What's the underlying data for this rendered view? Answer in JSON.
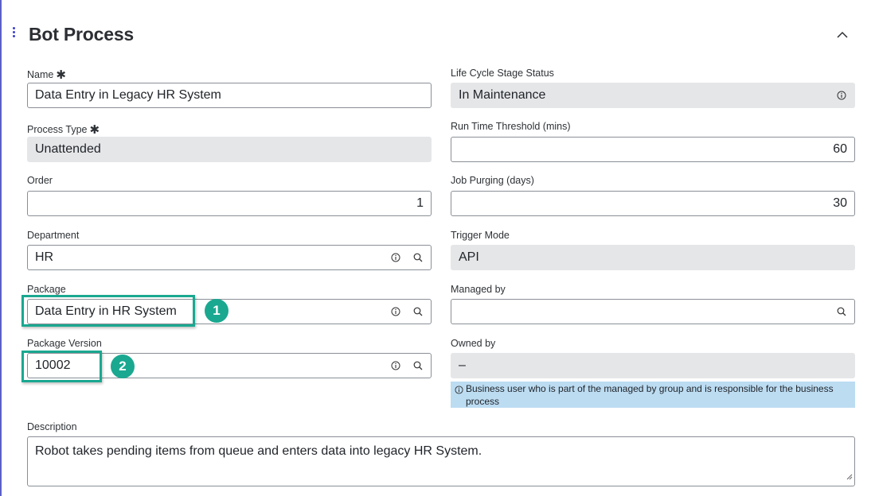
{
  "section": {
    "title": "Bot Process",
    "collapse_icon": "chevron-up-icon"
  },
  "fields": {
    "name": {
      "label": "Name",
      "value": "Data Entry in Legacy HR System"
    },
    "lifecycle": {
      "label": "Life Cycle Stage Status",
      "value": "In Maintenance"
    },
    "process_type": {
      "label": "Process Type",
      "value": "Unattended"
    },
    "run_time": {
      "label": "Run Time Threshold (mins)",
      "value": "60"
    },
    "order": {
      "label": "Order",
      "value": "1"
    },
    "job_purging": {
      "label": "Job Purging (days)",
      "value": "30"
    },
    "department": {
      "label": "Department",
      "value": "HR"
    },
    "trigger_mode": {
      "label": "Trigger Mode",
      "value": "API"
    },
    "package": {
      "label": "Package",
      "value": "Data Entry in HR System"
    },
    "managed_by": {
      "label": "Managed by",
      "value": ""
    },
    "package_version": {
      "label": "Package Version",
      "value": "10002"
    },
    "owned_by": {
      "label": "Owned by",
      "value": "–",
      "hint": "Business user who is part of the managed by group and is responsible for the business process"
    },
    "description": {
      "label": "Description",
      "value": "Robot takes pending items from queue and enters data into legacy HR System."
    }
  },
  "required_marker": "✱",
  "annotations": [
    {
      "number": "1"
    },
    {
      "number": "2"
    }
  ],
  "colors": {
    "accent": "#1aa890",
    "readonly_bg": "#e5e6e8",
    "hint_bg": "#bcdcf2",
    "edge": "#5b5fc7"
  }
}
